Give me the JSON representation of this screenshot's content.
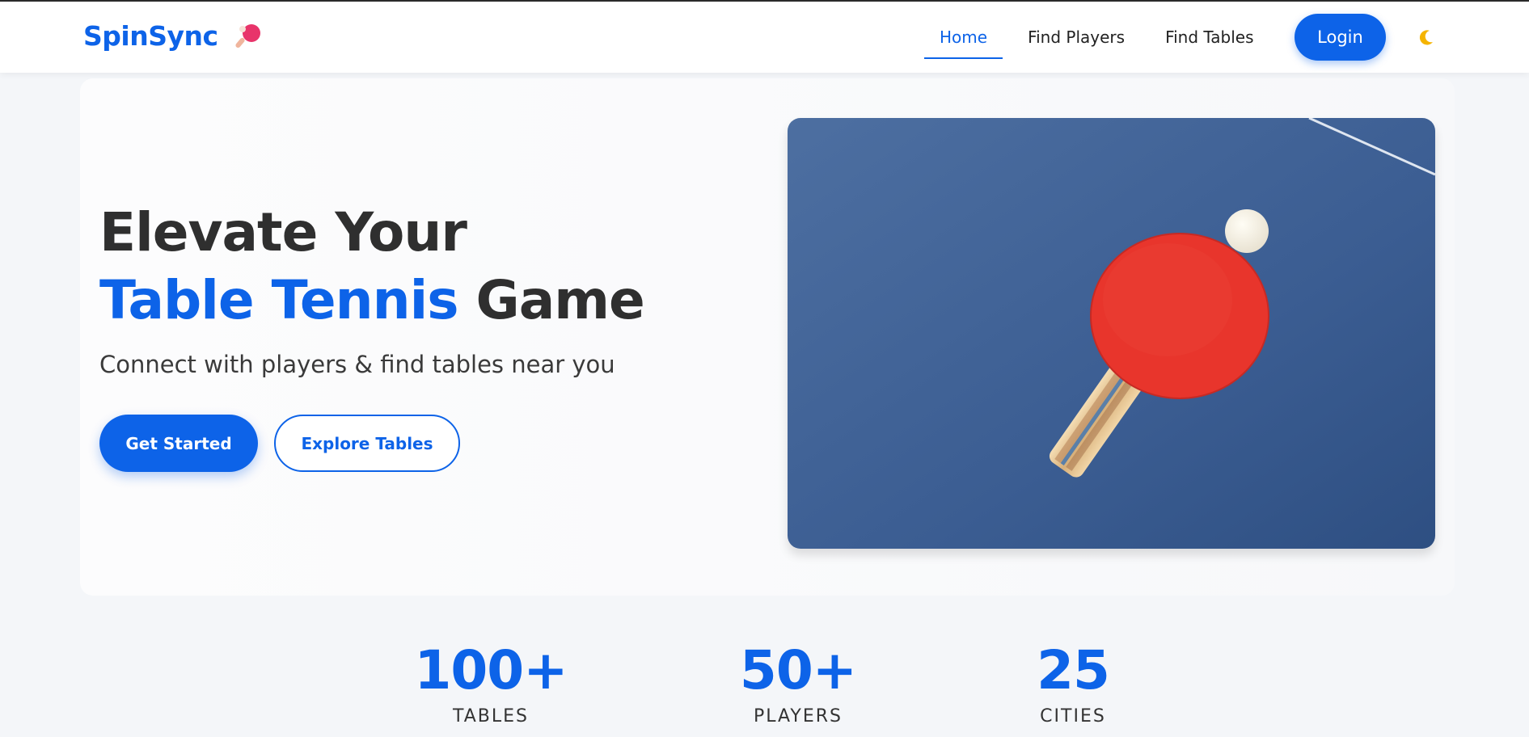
{
  "brand": {
    "name": "SpinSync",
    "logo_icon": "ping-pong-paddle-icon",
    "accent_color": "#0d63e8"
  },
  "nav": {
    "items": [
      {
        "label": "Home",
        "active": true
      },
      {
        "label": "Find Players",
        "active": false
      },
      {
        "label": "Find Tables",
        "active": false
      }
    ],
    "login_label": "Login",
    "theme_toggle_icon": "moon-icon"
  },
  "hero": {
    "headline_line1": "Elevate Your",
    "headline_accent": "Table Tennis",
    "headline_rest": "Game",
    "subheadline": "Connect with players & find tables near you",
    "primary_cta": "Get Started",
    "secondary_cta": "Explore Tables",
    "image": "ping-pong-paddle-and-ball-on-blue-table"
  },
  "stats": [
    {
      "value": "100+",
      "label": "TABLES"
    },
    {
      "value": "50+",
      "label": "PLAYERS"
    },
    {
      "value": "25",
      "label": "CITIES"
    }
  ]
}
